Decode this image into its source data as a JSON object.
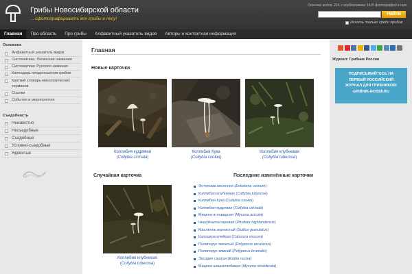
{
  "header": {
    "title": "Грибы Новосибирской области",
    "subtitle": "... сфотографировать все грибы в лесу!",
    "stats": "Описано видов: 224 и опубликовано 1415 фотографий к ним",
    "search_placeholder": "",
    "search_button": "Найти",
    "search_option": "Искать только среди грибов"
  },
  "nav": {
    "items": [
      "Главная",
      "Про область",
      "Про грибы",
      "Алфавитный указатель видов",
      "Авторы и контактная информация"
    ]
  },
  "sidebar": {
    "main_heading": "Основное",
    "main_items": [
      "Алфавитный указатель видов",
      "Систематика: Латинские названия",
      "Систематика: Русские названия",
      "Календарь плодоношения грибов",
      "Краткий словарь микологических терминов",
      "Ссылки",
      "События и мероприятия"
    ],
    "edible_heading": "Съедобность",
    "edible_items": [
      "Неизвестно",
      "Несъедобные",
      "Съедобные",
      "Условно-съедобные",
      "Ядовитые"
    ]
  },
  "main": {
    "page_title": "Главная",
    "new_cards_heading": "Новые карточки",
    "new_cards": [
      {
        "name": "Коллибия кудрявая",
        "latin": "Collybia cirrhata"
      },
      {
        "name": "Коллибия Кука",
        "latin": "Collybia cookei"
      },
      {
        "name": "Коллибия клубневая",
        "latin": "Collybia tuberosa"
      }
    ],
    "random_heading": "Случайная карточка",
    "random_card": {
      "name": "Коллибия клубневая",
      "latin": "Collybia tuberosa"
    },
    "changed_heading": "Последние изменённые карточки",
    "changed": [
      {
        "name": "Энтолома весенняя",
        "latin": "Entoloma vernum"
      },
      {
        "name": "Коллибия клубневая",
        "latin": "Collybia tuberosa"
      },
      {
        "name": "Коллибия Кука",
        "latin": "Collybia cookei"
      },
      {
        "name": "Коллибия кудрявая",
        "latin": "Collybia cirrhata"
      },
      {
        "name": "Мицена игловидная",
        "latin": "Mycena acicula"
      },
      {
        "name": "Чешуйчатка гаревая",
        "latin": "Pholiota highlandensis"
      },
      {
        "name": "Маслёнок зернистый",
        "latin": "Suillus granulatus"
      },
      {
        "name": "Калоцера клейкая",
        "latin": "Calocera viscosa"
      },
      {
        "name": "Полипорус ямчатый",
        "latin": "Polyporus arcularius"
      },
      {
        "name": "Полипорус зимний",
        "latin": "Polyporus brumalis"
      },
      {
        "name": "Эксидия сжатая",
        "latin": "Exidia recisa"
      },
      {
        "name": "Мицена шишколюбивая",
        "latin": "Mycena strobilicola"
      }
    ]
  },
  "rside": {
    "journal_label": "Журнал: Грибник России",
    "promo_lines": [
      "ПОДПИСЫВАЙТЕСЬ НА",
      "ПЕРВЫЙ РОССИЙСКИЙ",
      "ЖУРНАЛ ДЛЯ ГРИБНИКОВ!",
      "GRIBNIK-ROSSII.RU"
    ],
    "social_colors": [
      "#e05a2a",
      "#d62b2b",
      "#4c75a3",
      "#e8b000",
      "#3a5795",
      "#55acee",
      "#3fa63f",
      "#5c8ab8",
      "#2d6db5",
      "#777777"
    ]
  }
}
